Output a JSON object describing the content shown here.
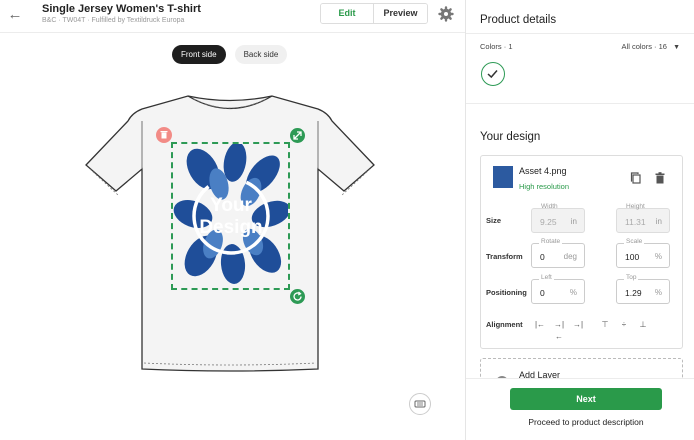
{
  "header": {
    "title": "Single Jersey Women's T-shirt",
    "subtitle": "B&C · TW04T · Fulfilled by Textildruck Europa",
    "edit_label": "Edit",
    "preview_label": "Preview"
  },
  "canvas": {
    "front_label": "Front side",
    "back_label": "Back side",
    "design_text_1": "Your",
    "design_text_2": "Design"
  },
  "panel": {
    "product_details_title": "Product details",
    "colors_label": "Colors · 1",
    "all_colors_label": "All colors · 16",
    "your_design_title": "Your design",
    "asset_name": "Asset 4.png",
    "resolution": "High resolution",
    "size_label": "Size",
    "width_caption": "Width",
    "width_value": "9.25",
    "width_unit": "in",
    "height_caption": "Height",
    "height_value": "11.31",
    "height_unit": "in",
    "transform_label": "Transform",
    "rotate_caption": "Rotate",
    "rotate_value": "0",
    "rotate_unit": "deg",
    "scale_caption": "Scale",
    "scale_value": "100",
    "scale_unit": "%",
    "positioning_label": "Positioning",
    "left_caption": "Left",
    "left_value": "0",
    "left_unit": "%",
    "top_caption": "Top",
    "top_value": "1.29",
    "top_unit": "%",
    "alignment_label": "Alignment",
    "add_layer_label": "Add Layer",
    "next_label": "Next",
    "proceed_label": "Proceed to product description"
  },
  "colors": {
    "accent": "#2a9a4a",
    "design_blue": "#1f4e99",
    "delete_handle": "#f28b86"
  }
}
